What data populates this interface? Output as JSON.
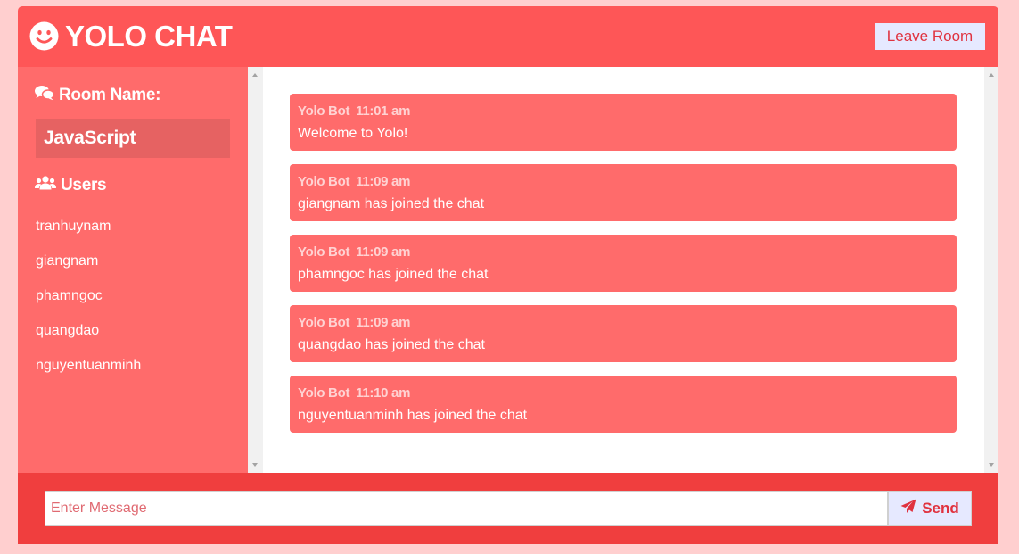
{
  "header": {
    "title": "YOLO CHAT",
    "logo_icon": "smile-icon",
    "leave_label": "Leave Room"
  },
  "sidebar": {
    "room_heading": "Room Name:",
    "room_icon": "comments-icon",
    "room_name": "JavaScript",
    "users_heading": "Users",
    "users_icon": "users-icon",
    "users": [
      "tranhuynam",
      "giangnam",
      "phamngoc",
      "quangdao",
      "nguyentuanminh"
    ]
  },
  "messages": [
    {
      "author": "Yolo Bot",
      "time": "11:01 am",
      "text": "Welcome to Yolo!"
    },
    {
      "author": "Yolo Bot",
      "time": "11:09 am",
      "text": "giangnam has joined the chat"
    },
    {
      "author": "Yolo Bot",
      "time": "11:09 am",
      "text": "phamngoc has joined the chat"
    },
    {
      "author": "Yolo Bot",
      "time": "11:09 am",
      "text": "quangdao has joined the chat"
    },
    {
      "author": "Yolo Bot",
      "time": "11:10 am",
      "text": "nguyentuanminh has joined the chat"
    }
  ],
  "composer": {
    "placeholder": "Enter Message",
    "value": "",
    "send_label": "Send",
    "send_icon": "paper-plane-icon"
  },
  "colors": {
    "header": "#fe5657",
    "sidebar": "#ff6b6b",
    "message_bubble": "#ff6b6b",
    "footer": "#f03e3e",
    "button_bg": "#e6e9ff",
    "button_text": "#e0323f",
    "page_bg": "#ffcfcf"
  }
}
